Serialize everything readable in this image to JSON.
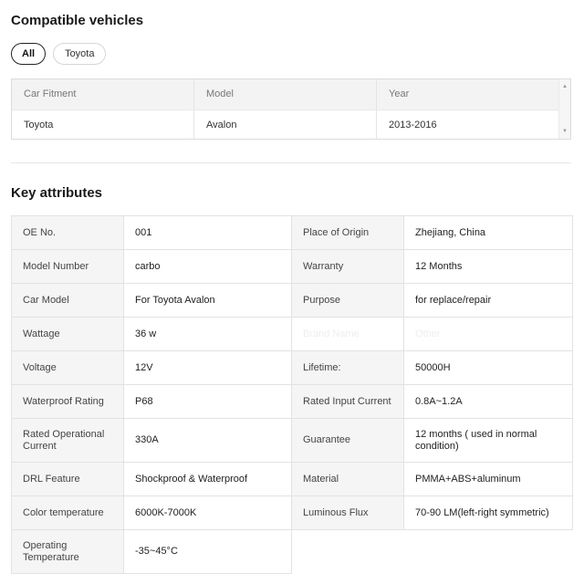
{
  "compatible": {
    "title": "Compatible vehicles",
    "filters": [
      "All",
      "Toyota"
    ],
    "active_filter": "All",
    "columns": [
      "Car Fitment",
      "Model",
      "Year"
    ],
    "rows": [
      [
        "Toyota",
        "Avalon",
        "2013-2016"
      ]
    ]
  },
  "attributes": {
    "title": "Key attributes",
    "rows": [
      {
        "l1": "OE No.",
        "v1": "001",
        "l2": "Place of Origin",
        "v2": "Zhejiang, China"
      },
      {
        "l1": "Model Number",
        "v1": "carbo",
        "l2": "Warranty",
        "v2": "12 Months"
      },
      {
        "l1": "Car Model",
        "v1": "For Toyota Avalon",
        "l2": "Purpose",
        "v2": "for replace/repair"
      },
      {
        "l1": "Wattage",
        "v1": "36 w",
        "l2": "Brand Name",
        "v2": "Other"
      },
      {
        "l1": "Voltage",
        "v1": "12V",
        "l2": "Lifetime:",
        "v2": "50000H"
      },
      {
        "l1": "Waterproof Rating",
        "v1": "P68",
        "l2": "Rated Input Current",
        "v2": "0.8A~1.2A"
      },
      {
        "l1": "Rated Operational Current",
        "v1": "330A",
        "l2": "Guarantee",
        "v2": "12 months ( used in normal condition)"
      },
      {
        "l1": "DRL Feature",
        "v1": "Shockproof & Waterproof",
        "l2": "Material",
        "v2": "PMMA+ABS+aluminum"
      },
      {
        "l1": "Color temperature",
        "v1": "6000K-7000K",
        "l2": "Luminous Flux",
        "v2": "70-90 LM(left-right symmetric)"
      },
      {
        "l1": "Operating Temperature",
        "v1": "-35~45°C",
        "l2": "",
        "v2": ""
      }
    ]
  }
}
